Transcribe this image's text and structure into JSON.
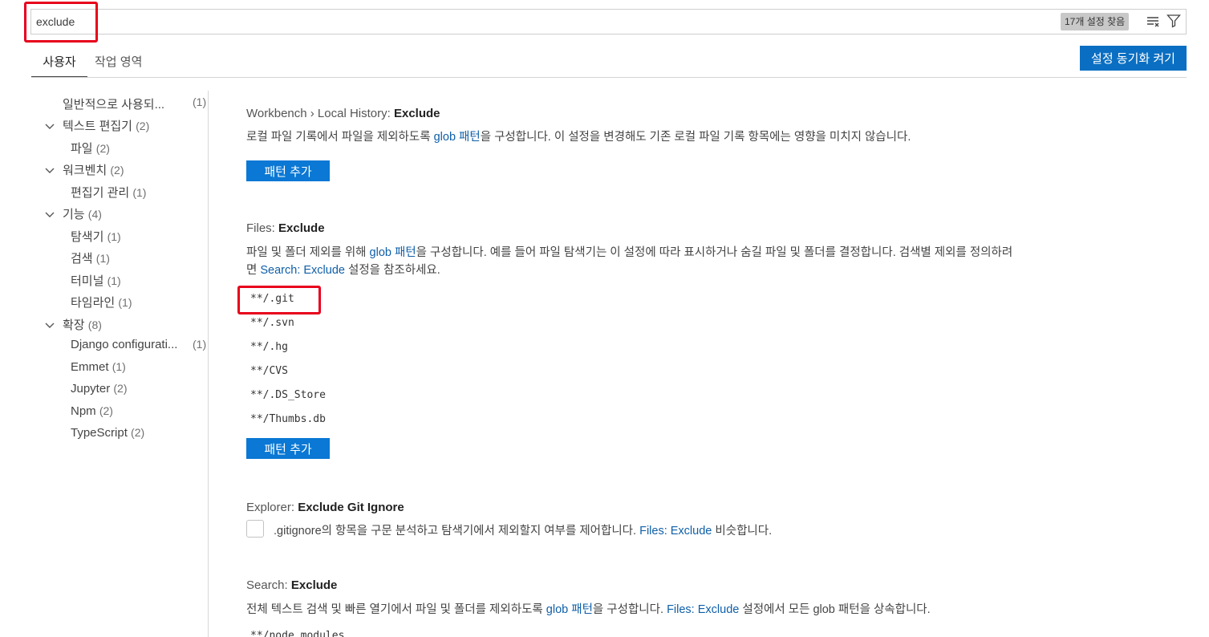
{
  "search": {
    "value": "exclude",
    "count_label": "17개 설정 찾음"
  },
  "tabs": {
    "user": "사용자",
    "workspace": "작업 영역"
  },
  "sync_button_label": "설정 동기화 켜기",
  "toc": [
    {
      "label": "일반적으로 사용되...",
      "count": "(1)"
    },
    {
      "label": "텍스트 편집기",
      "count": "(2)"
    },
    {
      "label": "파일",
      "count": "(2)"
    },
    {
      "label": "워크벤치",
      "count": "(2)"
    },
    {
      "label": "편집기 관리",
      "count": "(1)"
    },
    {
      "label": "기능",
      "count": "(4)"
    },
    {
      "label": "탐색기",
      "count": "(1)"
    },
    {
      "label": "검색",
      "count": "(1)"
    },
    {
      "label": "터미널",
      "count": "(1)"
    },
    {
      "label": "타임라인",
      "count": "(1)"
    },
    {
      "label": "확장",
      "count": "(8)"
    },
    {
      "label": "Django configurati...",
      "count": "(1)"
    },
    {
      "label": "Emmet",
      "count": "(1)"
    },
    {
      "label": "Jupyter",
      "count": "(2)"
    },
    {
      "label": "Npm",
      "count": "(2)"
    },
    {
      "label": "TypeScript",
      "count": "(2)"
    }
  ],
  "settings": {
    "local_history": {
      "category": "Workbench › Local History: ",
      "name": "Exclude",
      "desc_before": "로컬 파일 기록에서 파일을 제외하도록 ",
      "desc_link": "glob 패턴",
      "desc_after": "을 구성합니다. 이 설정을 변경해도 기존 로컬 파일 기록 항목에는 영향을 미치지 않습니다.",
      "add_button": "패턴 추가"
    },
    "files_exclude": {
      "category": "Files: ",
      "name": "Exclude",
      "desc1_before": "파일 및 폴더 제외를 위해 ",
      "desc1_link": "glob 패턴",
      "desc1_after": "을 구성합니다. 예를 들어 파일 탐색기는 이 설정에 따라 표시하거나 숨길 파일 및 폴더를 결정합니다. 검색별 제외를 정의하려",
      "desc2_before": "면 ",
      "desc2_link": "Search: Exclude",
      "desc2_after": " 설정을 참조하세요.",
      "patterns": [
        "**/.git",
        "**/.svn",
        "**/.hg",
        "**/CVS",
        "**/.DS_Store",
        "**/Thumbs.db"
      ],
      "add_button": "패턴 추가"
    },
    "explorer_git_ignore": {
      "category": "Explorer: ",
      "name": "Exclude Git Ignore",
      "desc_before": ".gitignore의 항목을 구문 분석하고 탐색기에서 제외할지 여부를 제어합니다. ",
      "desc_link": "Files: Exclude",
      "desc_after": " 비슷합니다."
    },
    "search_exclude": {
      "category": "Search: ",
      "name": "Exclude",
      "desc_before": "전체 텍스트 검색 및 빠른 열기에서 파일 및 폴더를 제외하도록 ",
      "desc_link1": "glob 패턴",
      "desc_mid": "을 구성합니다. ",
      "desc_link2": "Files: Exclude",
      "desc_after": " 설정에서 모든 glob 패턴을 상속합니다.",
      "first_pattern": "**/node_modules"
    }
  },
  "colors": {
    "accent": "#0a78d4",
    "highlight": "#e8001c",
    "link": "#0f5fa8"
  }
}
